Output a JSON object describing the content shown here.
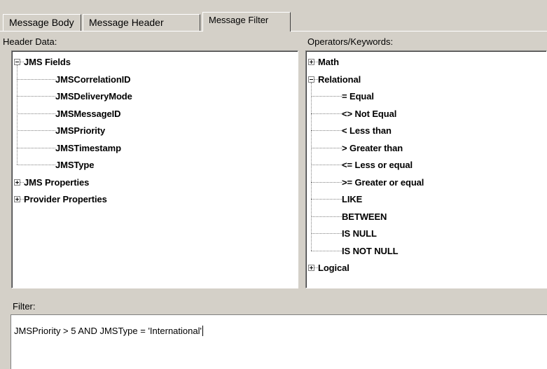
{
  "tabs": [
    {
      "label": "Message Body",
      "active": false
    },
    {
      "label": "Message Header",
      "active": false
    },
    {
      "label": "Message Filter",
      "active": true
    }
  ],
  "header_data": {
    "caption": "Header Data:",
    "tree": [
      {
        "label": "JMS Fields",
        "expanded": true,
        "children": [
          "JMSCorrelationID",
          "JMSDeliveryMode",
          "JMSMessageID",
          "JMSPriority",
          "JMSTimestamp",
          "JMSType"
        ]
      },
      {
        "label": "JMS Properties",
        "expanded": false
      },
      {
        "label": "Provider Properties",
        "expanded": false
      }
    ]
  },
  "operators": {
    "caption": "Operators/Keywords:",
    "tree": [
      {
        "label": "Math",
        "expanded": false
      },
      {
        "label": "Relational",
        "expanded": true,
        "children": [
          "= Equal",
          "<> Not Equal",
          "< Less than",
          "> Greater than",
          "<= Less or equal",
          ">= Greater or equal",
          "LIKE",
          "BETWEEN",
          "IS NULL",
          "IS NOT NULL"
        ]
      },
      {
        "label": "Logical",
        "expanded": false
      }
    ]
  },
  "filter": {
    "caption": "Filter:",
    "value": "JMSPriority > 5 AND JMSType = 'International'"
  }
}
